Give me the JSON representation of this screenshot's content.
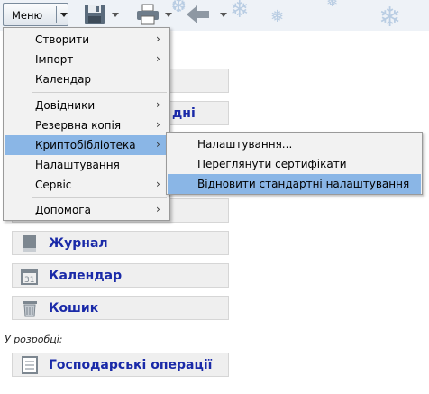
{
  "toolbar": {
    "menu_label": "Меню",
    "icons": [
      "save-icon",
      "print-icon",
      "back-arrow-icon"
    ]
  },
  "nav_buttons": [
    {
      "label": "Журнал",
      "icon": "journal-book-icon"
    },
    {
      "label": "Календар",
      "icon": "calendar-icon"
    },
    {
      "label": "Кошик",
      "icon": "trash-bin-icon"
    }
  ],
  "partial_visible_text": "дні",
  "section_label": "У розробці:",
  "dev_button": {
    "label": "Господарські операції",
    "icon": "document-icon"
  },
  "menu": {
    "items": [
      {
        "label": "Створити",
        "submenu": true
      },
      {
        "label": "Імпорт",
        "submenu": true
      },
      {
        "label": "Календар",
        "submenu": false
      },
      {
        "label": "Довідники",
        "submenu": true
      },
      {
        "label": "Резервна копія",
        "submenu": true
      },
      {
        "label": "Криптобібліотека",
        "submenu": true,
        "active": true
      },
      {
        "label": "Налаштування",
        "submenu": false
      },
      {
        "label": "Сервіс",
        "submenu": true
      },
      {
        "label": "Допомога",
        "submenu": true
      }
    ]
  },
  "submenu": {
    "items": [
      {
        "label": "Налаштування..."
      },
      {
        "label": "Переглянути сертифікати"
      },
      {
        "label": "Відновити стандартні налаштування",
        "active": true
      }
    ]
  },
  "colors": {
    "highlight": "#8ab6e6",
    "nav_text": "#1a2aa8",
    "menu_bg": "#f2f2f2"
  }
}
